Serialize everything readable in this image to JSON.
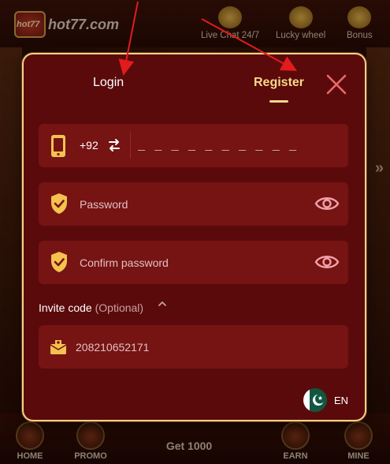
{
  "background": {
    "brand": "hot77.com",
    "badge": "hot77",
    "top_actions": [
      "Live Chat 24/7",
      "Lucky wheel",
      "Bonus"
    ],
    "bottom_nav": [
      "HOME",
      "PROMO",
      "Get 1000",
      "EARN",
      "MINE"
    ]
  },
  "modal": {
    "tabs": {
      "login": "Login",
      "register": "Register"
    },
    "active_tab": "Register",
    "phone": {
      "country_code": "+92",
      "placeholder": "_ _ _ _ _ _ _ _ _ _"
    },
    "password": {
      "placeholder": "Password"
    },
    "confirm_password": {
      "placeholder": "Confirm password"
    },
    "invite": {
      "label": "Invite code",
      "optional": "(Optional)",
      "value": "208210652171"
    },
    "language": {
      "label": "EN"
    }
  },
  "colors": {
    "modal_bg": "#5b0a0b",
    "field_bg": "#761313",
    "accent_gold": "#f6d98a",
    "icon_gold": "#f3c24f",
    "eye_pink": "#f0a0a8",
    "arrow_red": "#e21c1c"
  },
  "icons": [
    "phone-icon",
    "swap-icon",
    "shield-check-icon",
    "eye-icon",
    "envelope-icon",
    "chevron-up-icon",
    "close-icon",
    "pakistan-flag-icon"
  ]
}
